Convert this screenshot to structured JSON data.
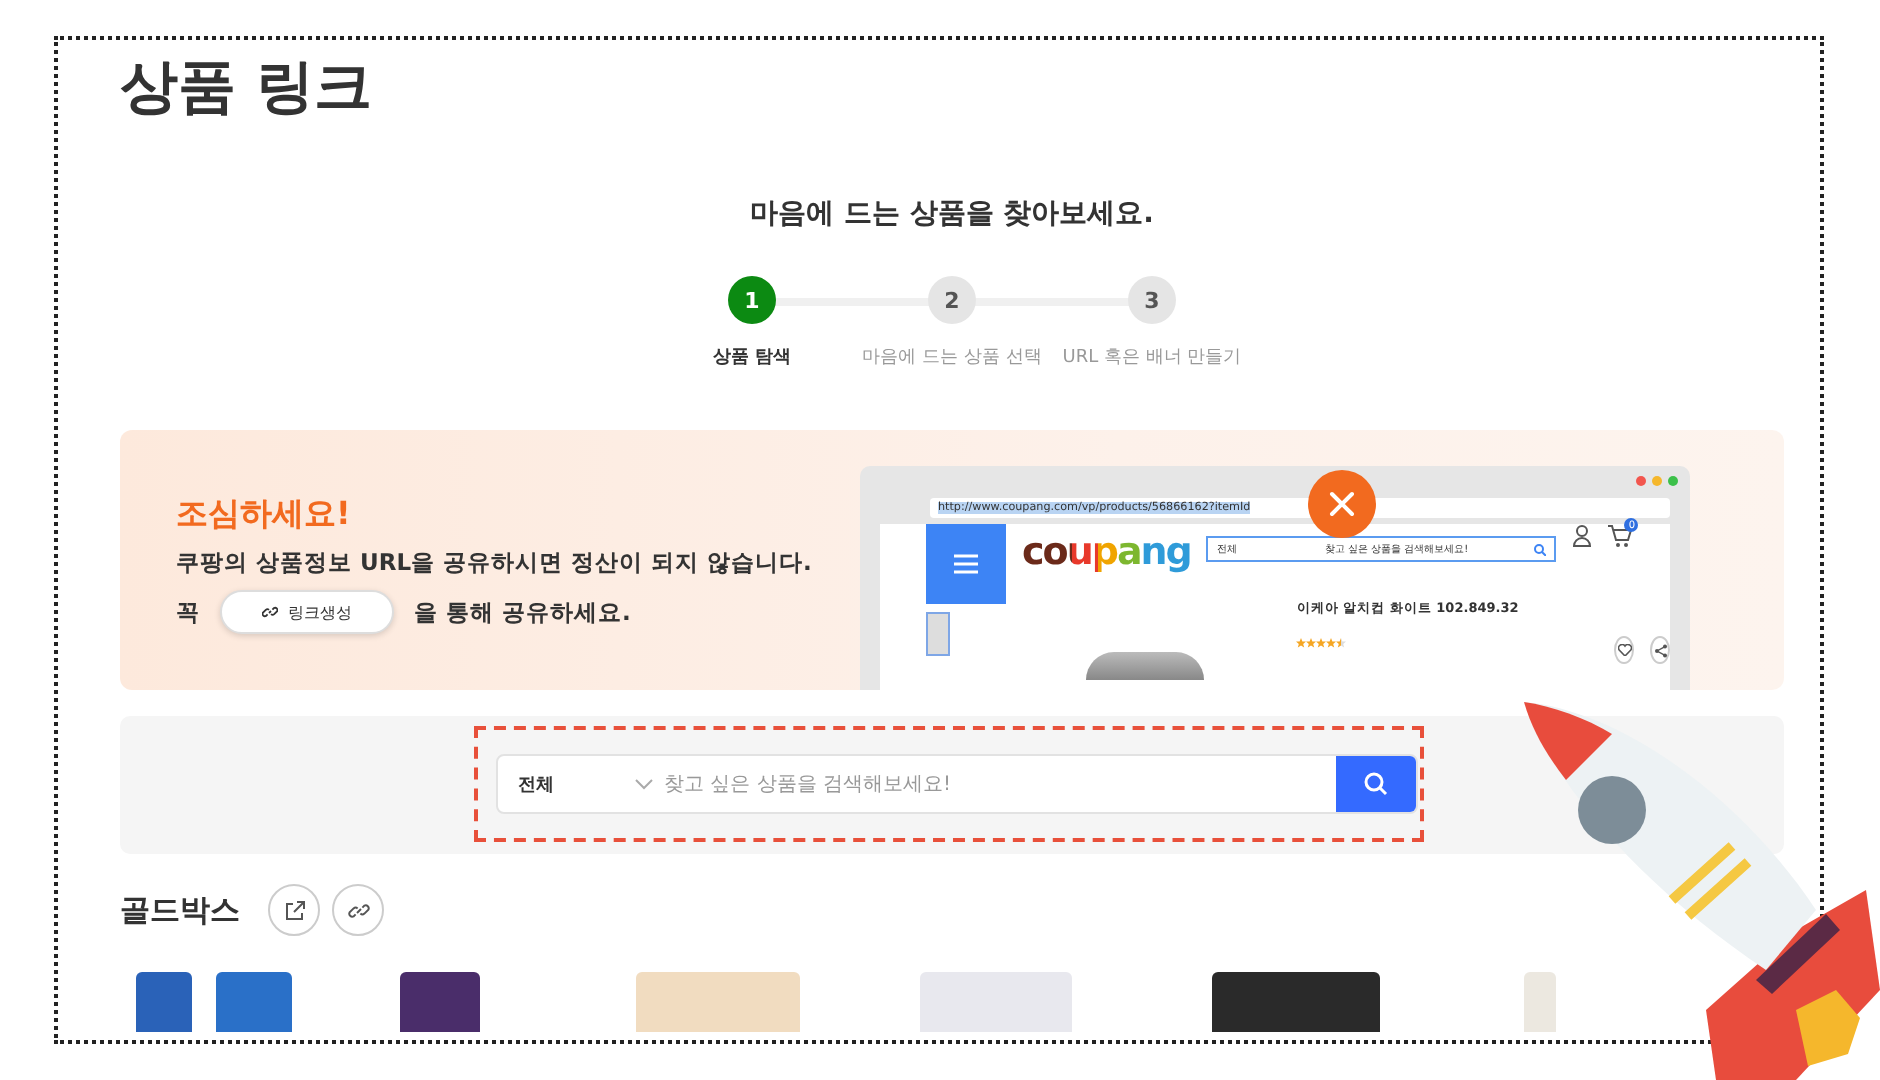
{
  "page_title": "상품 링크",
  "heading": "마음에 드는 상품을 찾아보세요.",
  "steps": [
    {
      "number": "1",
      "label": "상품 탐색",
      "selected": true
    },
    {
      "number": "2",
      "label": "마음에 드는 상품 선택",
      "selected": false
    },
    {
      "number": "3",
      "label": "URL 혹은 배너 만들기",
      "selected": false
    }
  ],
  "notice": {
    "title": "조심하세요!",
    "message": "쿠팡의 상품정보 URL을 공유하시면 정산이 되지 않습니다.",
    "prefix": "꼭",
    "button": "링크생성",
    "suffix": "을 통해 공유하세요."
  },
  "example_browser": {
    "url": "http://www.coupang.com/vp/products/56866162?itemId",
    "logo": "coupang",
    "category": "전체",
    "search_placeholder": "찾고 싶은 상품을 검색해보세요!",
    "cart_count": "0",
    "product_title": "이케아 알치컵 화이트 102.849.32",
    "stars": 4.5
  },
  "search": {
    "category": "전체",
    "placeholder": "찾고 싶은 상품을 검색해보세요!"
  },
  "goldbox": {
    "title": "골드박스"
  }
}
